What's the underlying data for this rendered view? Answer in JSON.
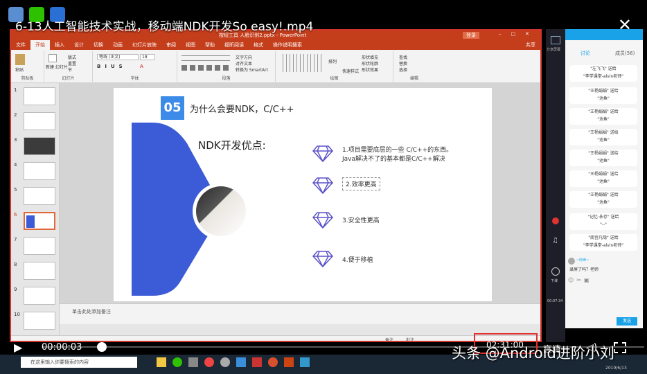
{
  "video": {
    "title": "6-13人工智能技术实战，移动端NDK开发So easy!.mp4",
    "time": "00:00:03",
    "duration": "02:31:00",
    "quality": "高清",
    "watermark": "头条 @Android进阶小刘"
  },
  "ppt": {
    "window_title": "按钮工具 人脸识别2.pptx - PowerPoint",
    "login": "登录",
    "share": "共享",
    "tabs": [
      "文件",
      "开始",
      "插入",
      "设计",
      "切换",
      "动画",
      "幻灯片放映",
      "审阅",
      "视图",
      "帮助",
      "福昕阅读",
      "格式",
      "操作说明搜索"
    ],
    "ribbon": {
      "paste": "粘贴",
      "new_slide": "新建\n幻灯片",
      "layout": "版式",
      "reset": "重置",
      "section": "节",
      "font_name": "等线 (正文)",
      "font_size": "18",
      "text_dir": "文字方向",
      "align_text": "对齐文本",
      "smartart": "转换为 SmartArt",
      "arrange": "排列",
      "quick_styles": "快速样式",
      "shape_fill": "形状填充",
      "shape_outline": "形状轮廓",
      "shape_effects": "形状效果",
      "find": "查找",
      "replace": "替换",
      "select": "选择",
      "groups": [
        "剪贴板",
        "幻灯片",
        "字体",
        "段落",
        "绘图",
        "编辑"
      ]
    },
    "slide_numbers": [
      "1",
      "2",
      "3",
      "4",
      "5",
      "6",
      "7",
      "8",
      "9",
      "10",
      "11"
    ],
    "notes": "单击此处添加备注",
    "status": {
      "notes": "备注",
      "comments": "批注"
    }
  },
  "slide": {
    "number": "05",
    "heading": "为什么会要NDK，C/C++",
    "subheading": "NDK开发优点:",
    "points": [
      "1.项目需要底层的一些 C/C++的东西。\nJava解决不了的基本都是C/C++解决",
      "2.效率更高",
      "3.安全性更高",
      "4.便于移植"
    ]
  },
  "chat": {
    "tab_discuss": "讨论",
    "tab_members": "成员(56)",
    "messages": [
      [
        "\"左飞飞\" 送给",
        "\"李学课堂-alvin老师\""
      ],
      [
        "\"王杨娟娟\" 送给",
        "\"池鱼\""
      ],
      [
        "\"王杨娟娟\" 送给",
        "\"池鱼\""
      ],
      [
        "\"王杨娟娟\" 送给",
        "\"池鱼\""
      ],
      [
        "\"王杨娟娟\" 送给",
        "\"池鱼\""
      ],
      [
        "\"王杨娟娟\" 送给",
        "\"池鱼\""
      ],
      [
        "\"王杨娟娟\" 送给",
        "\"池鱼\""
      ],
      [
        "\"记忆·永存\" 送给",
        "\"--\""
      ],
      [
        "\"南宫凡隐\" 送给",
        "\"李学课堂-alvin老师\""
      ]
    ],
    "user_msg_name": "~阿命~",
    "user_msg": "录屏了吗？老师",
    "send": "发送",
    "share_screen": "分享屏幕",
    "download": "下课",
    "timer": "00:07:34",
    "date": "2019/6/13"
  },
  "taskbar": {
    "search": "在这里输入你要搜索的内容",
    "time": "21:36"
  }
}
